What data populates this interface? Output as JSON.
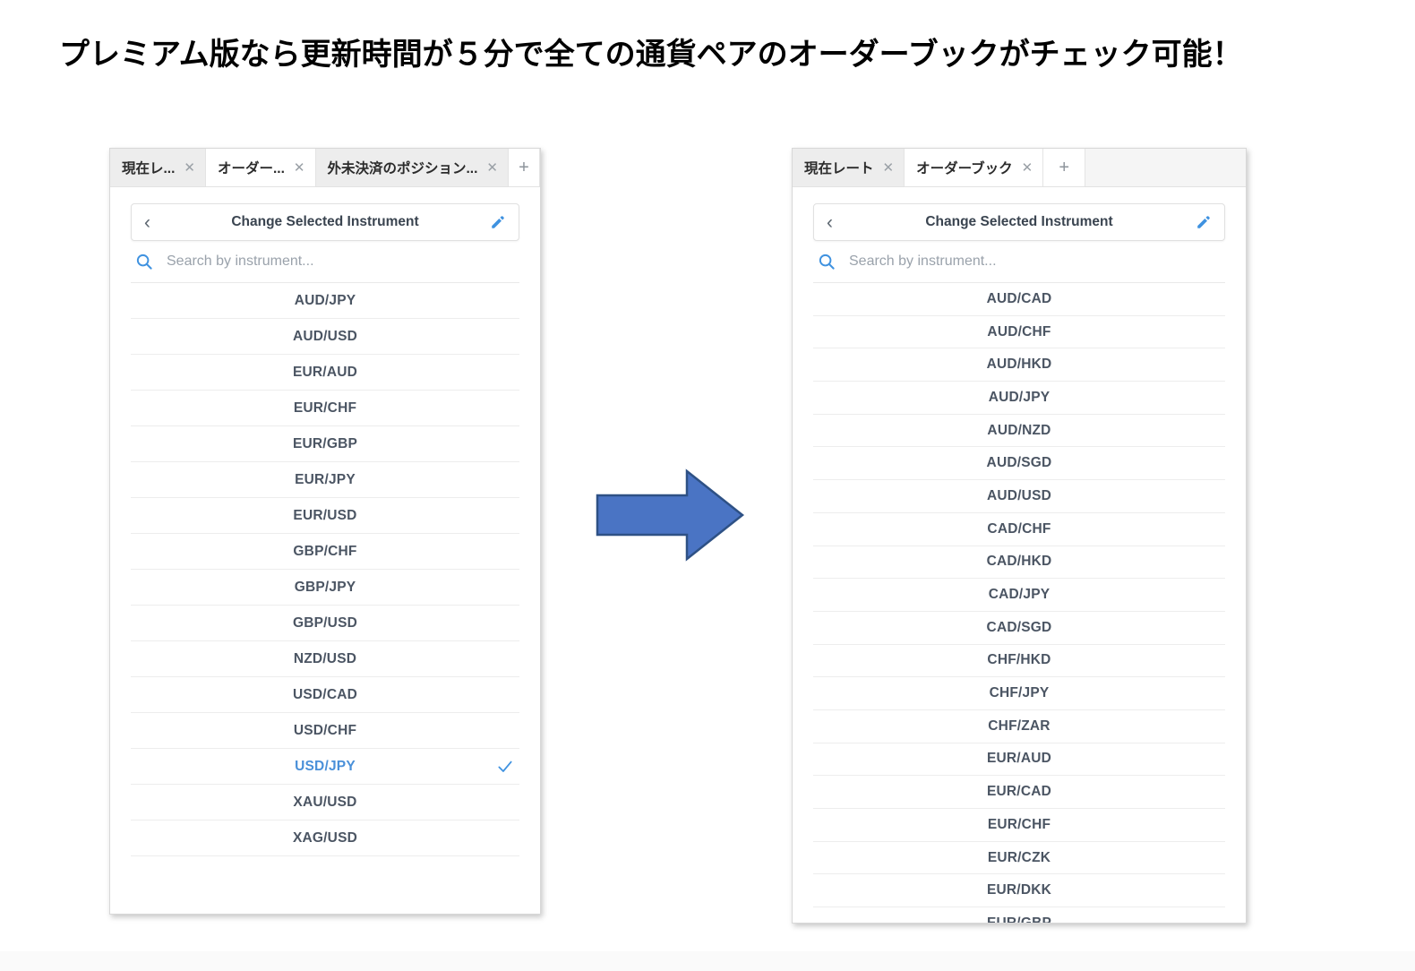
{
  "headline": "プレミアム版なら更新時間が５分で全ての通貨ペアのオーダーブックがチェック可能！",
  "colors": {
    "accent_blue": "#4a90d9",
    "arrow_fill": "#4a74c4",
    "arrow_stroke": "#2e5185",
    "text_dark": "#4b5563",
    "tab_inactive_bg": "#ededed",
    "tab_active_bg": "#ffffff"
  },
  "left_panel": {
    "tabs": [
      {
        "label": "現在レ...",
        "close": "✕",
        "active": false
      },
      {
        "label": "オーダー...",
        "close": "✕",
        "active": true
      },
      {
        "label": "外未決済のポジション...",
        "close": "✕",
        "active": false
      }
    ],
    "add_tab_label": "+",
    "header": {
      "back_label": "‹",
      "title": "Change Selected Instrument",
      "edit_icon": "pencil-icon"
    },
    "search": {
      "icon": "search-icon",
      "value": "",
      "placeholder": "Search by instrument..."
    },
    "instruments": [
      {
        "symbol": "AUD/JPY",
        "selected": false
      },
      {
        "symbol": "AUD/USD",
        "selected": false
      },
      {
        "symbol": "EUR/AUD",
        "selected": false
      },
      {
        "symbol": "EUR/CHF",
        "selected": false
      },
      {
        "symbol": "EUR/GBP",
        "selected": false
      },
      {
        "symbol": "EUR/JPY",
        "selected": false
      },
      {
        "symbol": "EUR/USD",
        "selected": false
      },
      {
        "symbol": "GBP/CHF",
        "selected": false
      },
      {
        "symbol": "GBP/JPY",
        "selected": false
      },
      {
        "symbol": "GBP/USD",
        "selected": false
      },
      {
        "symbol": "NZD/USD",
        "selected": false
      },
      {
        "symbol": "USD/CAD",
        "selected": false
      },
      {
        "symbol": "USD/CHF",
        "selected": false
      },
      {
        "symbol": "USD/JPY",
        "selected": true
      },
      {
        "symbol": "XAU/USD",
        "selected": false
      },
      {
        "symbol": "XAG/USD",
        "selected": false
      }
    ]
  },
  "right_panel": {
    "tabs": [
      {
        "label": "現在レート",
        "close": "✕",
        "active": false
      },
      {
        "label": "オーダーブック",
        "close": "✕",
        "active": true
      }
    ],
    "add_tab_label": "+",
    "header": {
      "back_label": "‹",
      "title": "Change Selected Instrument",
      "edit_icon": "pencil-icon"
    },
    "search": {
      "icon": "search-icon",
      "value": "",
      "placeholder": "Search by instrument..."
    },
    "instruments": [
      {
        "symbol": "AUD/CAD",
        "selected": false
      },
      {
        "symbol": "AUD/CHF",
        "selected": false
      },
      {
        "symbol": "AUD/HKD",
        "selected": false
      },
      {
        "symbol": "AUD/JPY",
        "selected": false
      },
      {
        "symbol": "AUD/NZD",
        "selected": false
      },
      {
        "symbol": "AUD/SGD",
        "selected": false
      },
      {
        "symbol": "AUD/USD",
        "selected": false
      },
      {
        "symbol": "CAD/CHF",
        "selected": false
      },
      {
        "symbol": "CAD/HKD",
        "selected": false
      },
      {
        "symbol": "CAD/JPY",
        "selected": false
      },
      {
        "symbol": "CAD/SGD",
        "selected": false
      },
      {
        "symbol": "CHF/HKD",
        "selected": false
      },
      {
        "symbol": "CHF/JPY",
        "selected": false
      },
      {
        "symbol": "CHF/ZAR",
        "selected": false
      },
      {
        "symbol": "EUR/AUD",
        "selected": false
      },
      {
        "symbol": "EUR/CAD",
        "selected": false
      },
      {
        "symbol": "EUR/CHF",
        "selected": false
      },
      {
        "symbol": "EUR/CZK",
        "selected": false
      },
      {
        "symbol": "EUR/DKK",
        "selected": false
      },
      {
        "symbol": "EUR/GBP",
        "selected": false
      }
    ]
  },
  "arrow": {
    "icon": "right-arrow-icon",
    "direction": "right"
  }
}
